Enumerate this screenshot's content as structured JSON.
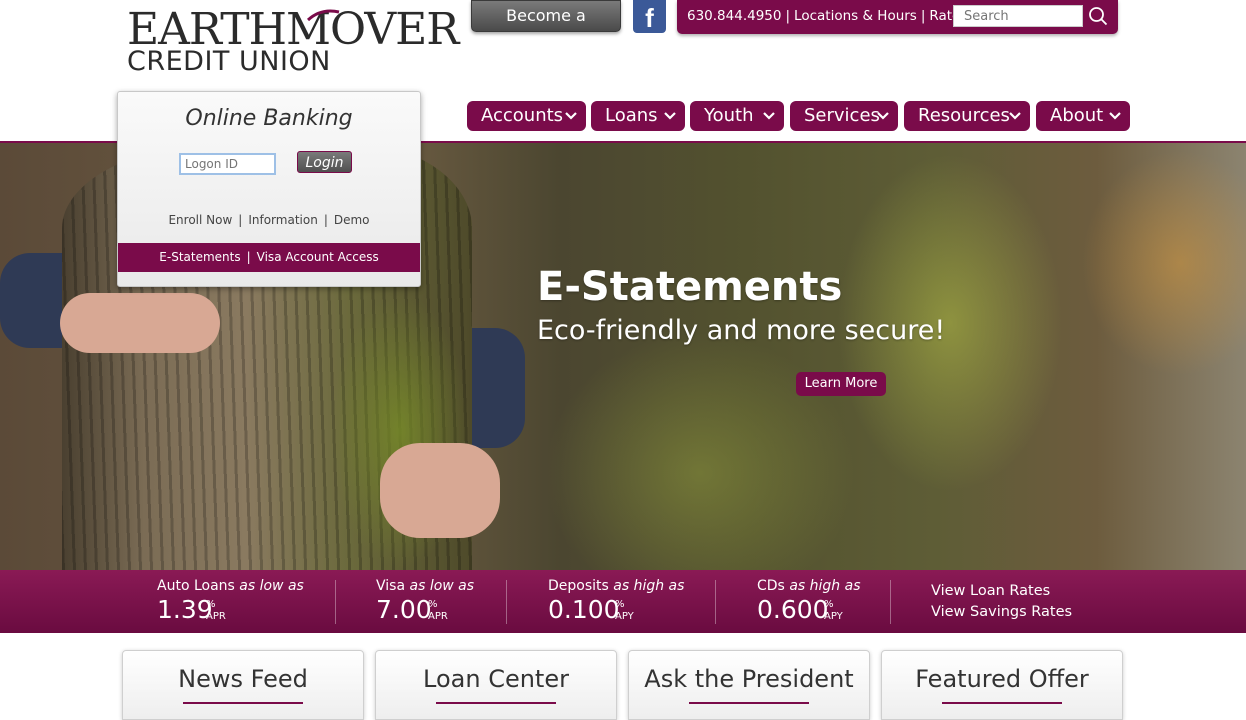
{
  "header": {
    "logo_line1": "EARTHMOVER",
    "logo_line2": "CREDIT UNION",
    "become_member": "Become a Member",
    "facebook_icon": "facebook-icon",
    "phone": "630.844.4950",
    "locations": "Locations & Hours",
    "rates": "Rates",
    "search_placeholder": "Search",
    "search_icon": "search-icon"
  },
  "nav": [
    {
      "label": "Accounts"
    },
    {
      "label": "Loans"
    },
    {
      "label": "Youth"
    },
    {
      "label": "Services"
    },
    {
      "label": "Resources"
    },
    {
      "label": "About"
    }
  ],
  "online_banking": {
    "title": "Online Banking",
    "logon_placeholder": "Logon ID",
    "login_button": "Login",
    "links": [
      "Enroll Now",
      "Information",
      "Demo"
    ],
    "bottom_links": [
      "E-Statements",
      "Visa Account Access"
    ]
  },
  "hero": {
    "title": "E-Statements",
    "subtitle": "Eco-friendly and more secure!",
    "cta": "Learn More"
  },
  "rates": [
    {
      "label_main": "Auto Loans",
      "label_qual": "as low as",
      "value": "1.39",
      "unit": "APR"
    },
    {
      "label_main": "Visa",
      "label_qual": "as low as",
      "value": "7.00",
      "unit": "APR"
    },
    {
      "label_main": "Deposits",
      "label_qual": "as high as",
      "value": "0.100",
      "unit": "APY"
    },
    {
      "label_main": "CDs",
      "label_qual": "as high as",
      "value": "0.600",
      "unit": "APY"
    }
  ],
  "percent_sign": "%",
  "rate_links": [
    "View Loan Rates",
    "View Savings Rates"
  ],
  "tabs": [
    {
      "label": "News Feed"
    },
    {
      "label": "Loan Center"
    },
    {
      "label": "Ask the President"
    },
    {
      "label": "Featured Offer"
    }
  ],
  "colors": {
    "brand": "#7a0b4a",
    "facebook": "#3b5998"
  }
}
